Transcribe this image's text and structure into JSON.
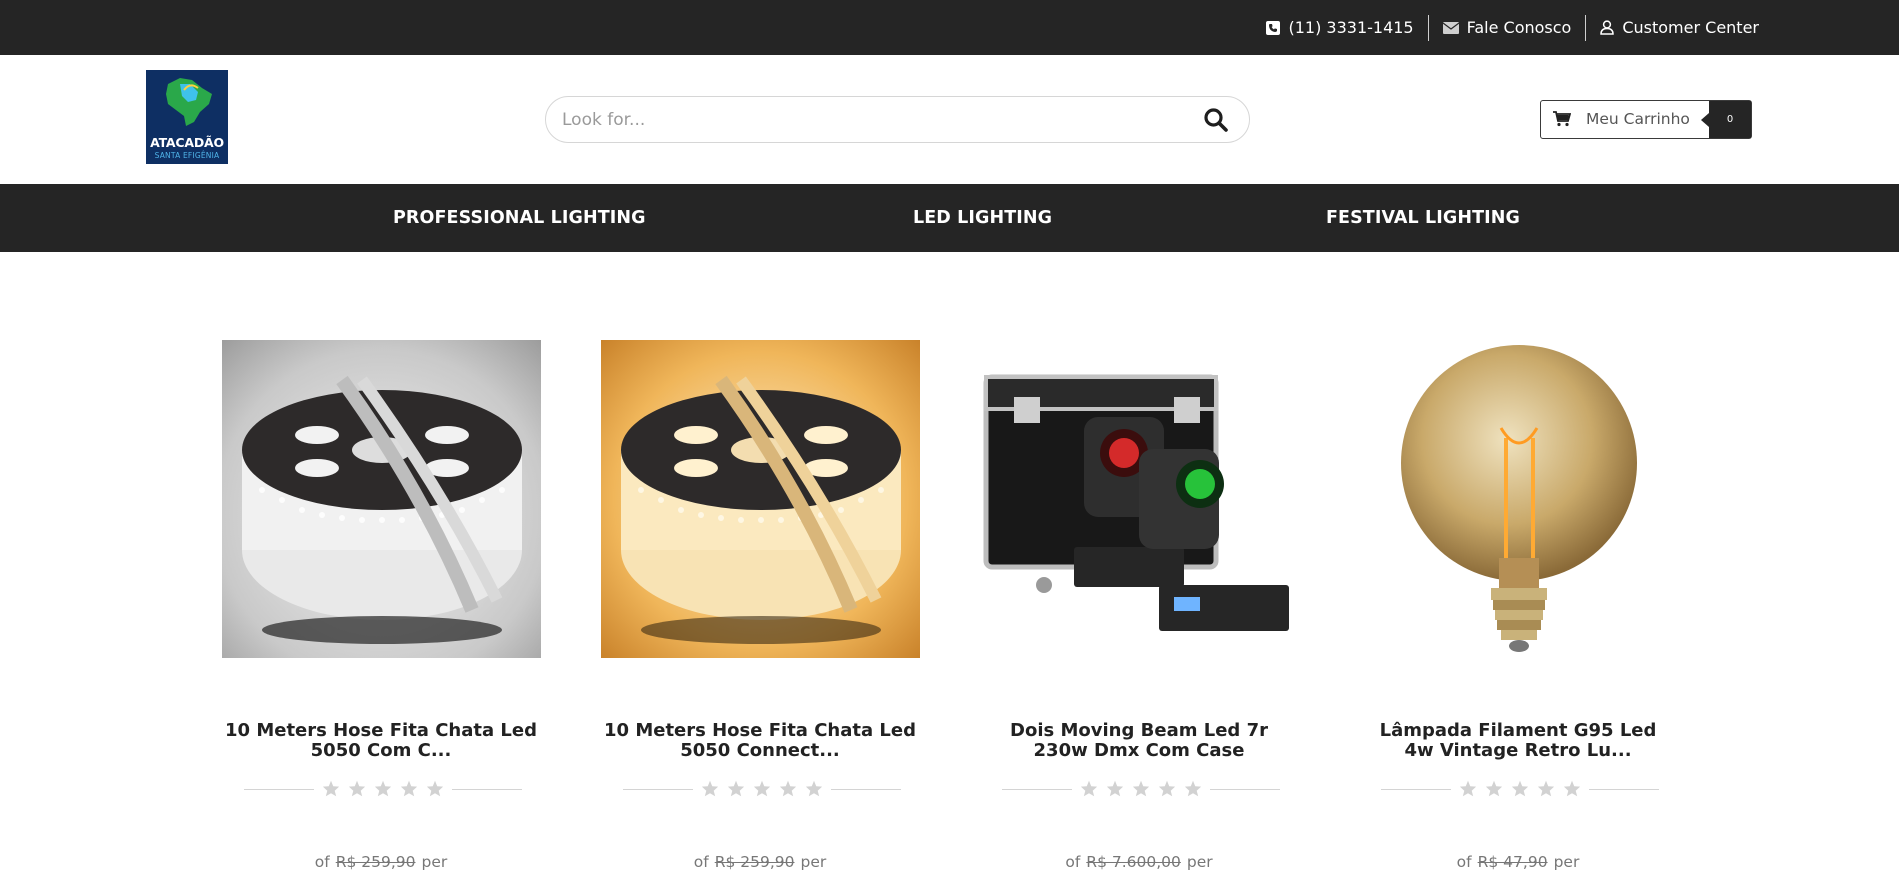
{
  "topbar": {
    "phone": "(11) 3331-1415",
    "contact": "Fale Conosco",
    "customer_center": "Customer Center"
  },
  "header": {
    "logo_line1": "ATACADÃO",
    "logo_line2": "SANTA EFIGÊNIA",
    "search_placeholder": "Look for...",
    "cart_label": "Meu Carrinho",
    "cart_count": "0"
  },
  "nav": {
    "items": [
      "PROFESSIONAL LIGHTING",
      "LED LIGHTING",
      "FESTIVAL LIGHTING"
    ]
  },
  "products": [
    {
      "name_line1": "10 Meters Hose Fita Chata Led",
      "name_line2": "5050 Com C...",
      "price_prefix": "of",
      "old_price": "R$ 259,90",
      "price_suffix": "per",
      "rating": 0
    },
    {
      "name_line1": "10 Meters Hose Fita Chata Led",
      "name_line2": "5050 Connect...",
      "price_prefix": "of",
      "old_price": "R$ 259,90",
      "price_suffix": "per",
      "rating": 0
    },
    {
      "name_line1": "Dois Moving Beam Led 7r",
      "name_line2": "230w Dmx Com Case",
      "price_prefix": "of",
      "old_price": "R$ 7.600,00",
      "price_suffix": "per",
      "rating": 0
    },
    {
      "name_line1": "Lâmpada Filament G95 Led",
      "name_line2": "4w Vintage Retro Lu...",
      "price_prefix": "of",
      "old_price": "R$ 47,90",
      "price_suffix": "per",
      "rating": 0
    }
  ],
  "colors": {
    "bar_bg": "#252525",
    "star": "#d2d2d2",
    "logo_bg": "#0e2f63"
  }
}
